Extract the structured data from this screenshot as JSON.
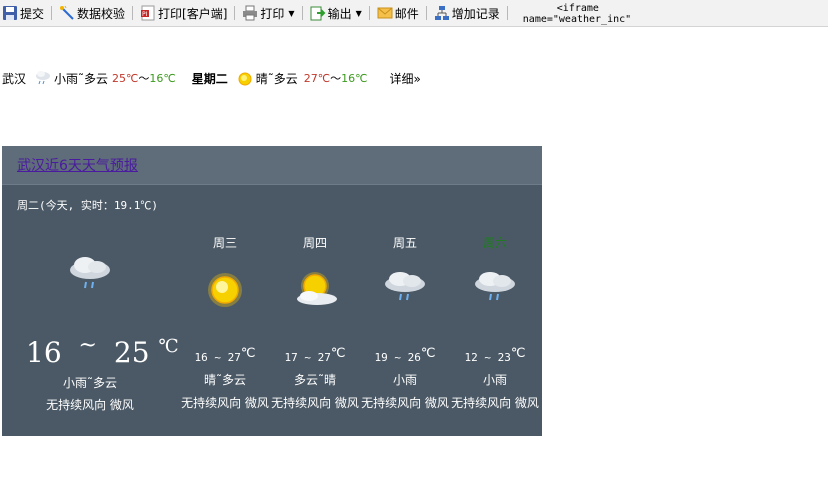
{
  "toolbar": {
    "items": [
      {
        "label": "提交",
        "icon": "save-disk-icon"
      },
      {
        "label": "数据校验",
        "icon": "wand-icon"
      },
      {
        "label": "打印[客户端]",
        "icon": "pdf-print-icon"
      },
      {
        "label": "打印",
        "icon": "printer-icon",
        "dropdown": true
      },
      {
        "label": "输出",
        "icon": "export-icon",
        "dropdown": true
      },
      {
        "label": "邮件",
        "icon": "mail-icon"
      },
      {
        "label": "增加记录",
        "icon": "add-record-icon"
      }
    ],
    "code_line1": "<iframe",
    "code_line2": "name=\"weather_inc\""
  },
  "mini_weather": {
    "city": "武汉",
    "today_cond": "小雨˜多云",
    "today_hi": "25℃",
    "today_sep": "～",
    "today_lo": "16℃",
    "next_day": "星期二",
    "next_cond": "晴˜多云",
    "next_hi": "27℃",
    "next_sep": "～",
    "next_lo": "16℃",
    "detail": "详细»"
  },
  "forecast": {
    "title": "武汉近6天天气预报",
    "today_line": "周二(今天, 实时：19.1℃)",
    "today_low": "16",
    "today_tilde": "~",
    "today_high": "25",
    "today_unit": "℃",
    "today_cond": "小雨˜多云",
    "today_wind": "无持续风向 微风",
    "days": [
      {
        "name": "周三",
        "temp": "16 ~ 27",
        "unit": "℃",
        "cond": "晴˜多云",
        "wind": "无持续风向 微风",
        "icon": "sun-icon"
      },
      {
        "name": "周四",
        "temp": "17 ~ 27",
        "unit": "℃",
        "cond": "多云˜晴",
        "wind": "无持续风向 微风",
        "icon": "partly-cloudy-icon"
      },
      {
        "name": "周五",
        "temp": "19 ~ 26",
        "unit": "℃",
        "cond": "小雨",
        "wind": "无持续风向 微风",
        "icon": "rain-cloud-icon"
      },
      {
        "name": "周六",
        "temp": "12 ~ 23",
        "unit": "℃",
        "cond": "小雨",
        "wind": "无持续风向 微风",
        "icon": "rain-cloud-icon"
      }
    ],
    "weekend_color": "#1a7f1a"
  }
}
